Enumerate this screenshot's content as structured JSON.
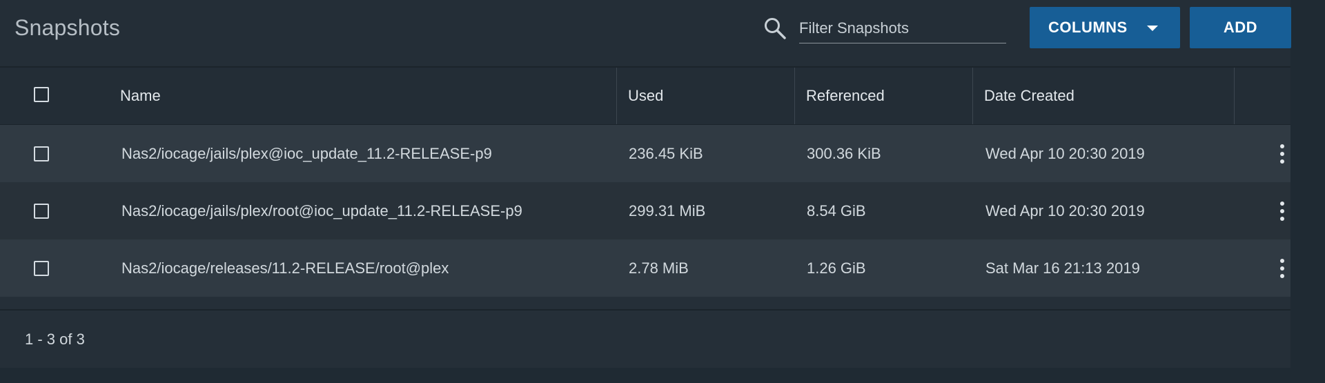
{
  "header": {
    "title": "Snapshots",
    "search": {
      "placeholder": "Filter Snapshots",
      "value": ""
    },
    "columns_label": "COLUMNS",
    "add_label": "ADD"
  },
  "table": {
    "columns": [
      "Name",
      "Used",
      "Referenced",
      "Date Created"
    ],
    "rows": [
      {
        "name": "Nas2/iocage/jails/plex@ioc_update_11.2-RELEASE-p9",
        "used": "236.45 KiB",
        "referenced": "300.36 KiB",
        "date_created": "Wed Apr 10 20:30 2019"
      },
      {
        "name": "Nas2/iocage/jails/plex/root@ioc_update_11.2-RELEASE-p9",
        "used": "299.31 MiB",
        "referenced": "8.54 GiB",
        "date_created": "Wed Apr 10 20:30 2019"
      },
      {
        "name": "Nas2/iocage/releases/11.2-RELEASE/root@plex",
        "used": "2.78 MiB",
        "referenced": "1.26 GiB",
        "date_created": "Sat Mar 16 21:13 2019"
      }
    ]
  },
  "footer": {
    "pagination": "1 - 3 of 3"
  },
  "colors": {
    "accent": "#175e96",
    "background": "#1f2a33",
    "row_alt": "#303a43"
  }
}
